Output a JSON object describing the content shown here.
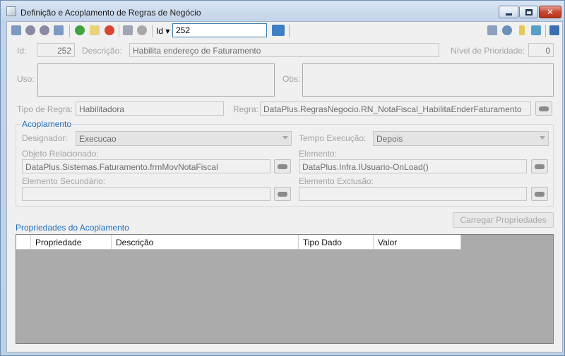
{
  "window": {
    "title": "Definição e Acoplamento de Regras de Negócio",
    "controls": {
      "minimize": "─",
      "maximize": "□",
      "close": "✕"
    }
  },
  "toolbar": {
    "search_field_label": "Id",
    "search_value": "252",
    "icons": [
      "first-icon",
      "previous-icon",
      "next-icon",
      "last-icon",
      "add-icon",
      "edit-icon",
      "delete-icon",
      "save-icon",
      "undo-icon",
      "search-go-icon",
      "windows-icon",
      "settings-icon",
      "filter-icon",
      "export-icon",
      "layout-icon"
    ]
  },
  "form": {
    "id_label": "Id:",
    "id_value": "252",
    "descricao_label": "Descrição:",
    "descricao_value": "Habilita endereço de Faturamento",
    "prioridade_label": "Nível de Prioridade:",
    "prioridade_value": "0",
    "uso_label": "Uso:",
    "uso_value": "",
    "obs_label": "Obs:",
    "obs_value": "",
    "tipo_regra_label": "Tipo de Regra:",
    "tipo_regra_value": "Habilitadora",
    "regra_label": "Regra:",
    "regra_value": "DataPlus.RegrasNegocio.RN_NotaFiscal_HabilitaEnderFaturamento"
  },
  "acoplamento": {
    "title": "Acoplamento",
    "designador_label": "Designador:",
    "designador_value": "Execucao",
    "tempo_label": "Tempo Execução:",
    "tempo_value": "Depois",
    "objeto_label": "Objeto Relacionado:",
    "objeto_value": "DataPlus.Sistemas.Faturamento.frmMovNotaFiscal",
    "elemento_label": "Elemento:",
    "elemento_value": "DataPlus.Infra.IUsuario-OnLoad()",
    "secundario_label": "Elemento Secundário:",
    "secundario_value": "",
    "exclusao_label": "Elemento Exclusão:",
    "exclusao_value": ""
  },
  "propriedades": {
    "title": "Propriedades do Acoplamento",
    "load_button": "Carregar Propriedades",
    "columns": [
      "",
      "Propriedade",
      "Descrição",
      "Tipo Dado",
      "Valor"
    ]
  },
  "colors": {
    "accent": "#1f6fb9",
    "grid_background": "#ababab",
    "close_button": "#c9462f"
  }
}
